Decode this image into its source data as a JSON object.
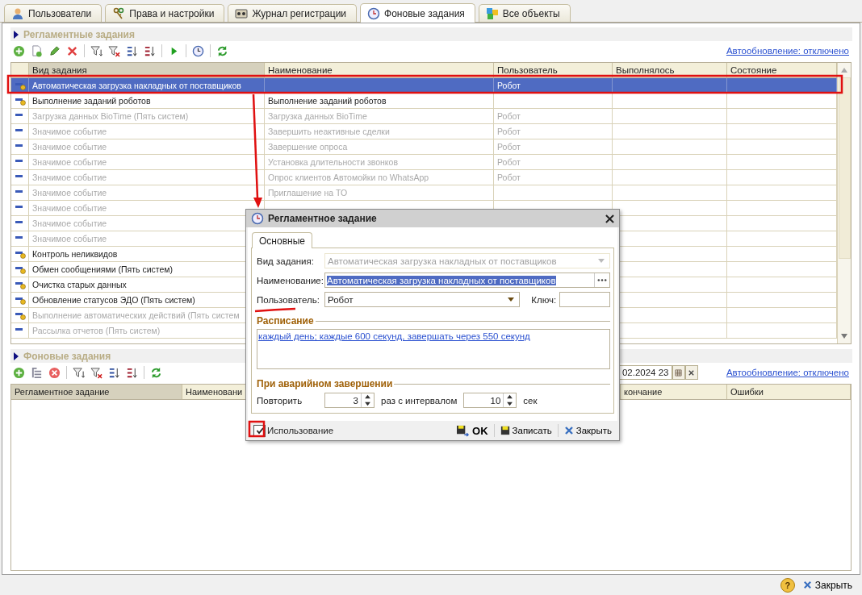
{
  "tabs": [
    {
      "label": "Пользователи",
      "kind": "users",
      "selected": false
    },
    {
      "label": "Права и настройки",
      "kind": "rights",
      "selected": false
    },
    {
      "label": "Журнал регистрации",
      "kind": "log",
      "selected": false
    },
    {
      "label": "Фоновые задания",
      "kind": "jobs",
      "selected": true
    },
    {
      "label": "Все объекты",
      "kind": "objects",
      "selected": false
    }
  ],
  "scheduled": {
    "title": "Регламентные задания",
    "autoupdate": "Автообновление: отключено",
    "columns": [
      "Вид задания",
      "Наименование",
      "Пользователь",
      "Выполнялось",
      "Состояние"
    ],
    "rows": [
      {
        "task": "Автоматическая загрузка накладных от поставщиков",
        "user": "Робот",
        "selected": true,
        "disabled": false,
        "predefined": true
      },
      {
        "task": "Выполнение заданий роботов",
        "name": "Выполнение заданий роботов",
        "selected": false,
        "disabled": false,
        "predefined": true
      },
      {
        "task": "Загрузка данных BioTime (Пять систем)",
        "name": "Загрузка данных BioTime",
        "user": "Робот",
        "selected": false,
        "disabled": true,
        "predefined": false
      },
      {
        "task": "Значимое событие",
        "name": "Завершить неактивные сделки",
        "user": "Робот",
        "selected": false,
        "disabled": true,
        "predefined": false
      },
      {
        "task": "Значимое событие",
        "name": "Завершение опроса",
        "user": "Робот",
        "selected": false,
        "disabled": true,
        "predefined": false
      },
      {
        "task": "Значимое событие",
        "name": "Установка длительности звонков",
        "user": "Робот",
        "selected": false,
        "disabled": true,
        "predefined": false
      },
      {
        "task": "Значимое событие",
        "name": "Опрос клиентов Автомойки по WhatsApp",
        "user": "Робот",
        "selected": false,
        "disabled": true,
        "predefined": false
      },
      {
        "task": "Значимое событие",
        "name": "Приглашение на ТО",
        "selected": false,
        "disabled": true,
        "predefined": false
      },
      {
        "task": "Значимое событие",
        "selected": false,
        "disabled": true,
        "predefined": false
      },
      {
        "task": "Значимое событие",
        "selected": false,
        "disabled": true,
        "predefined": false
      },
      {
        "task": "Значимое событие",
        "selected": false,
        "disabled": true,
        "predefined": false
      },
      {
        "task": "Контроль неликвидов",
        "selected": false,
        "disabled": false,
        "predefined": true
      },
      {
        "task": "Обмен сообщениями (Пять систем)",
        "selected": false,
        "disabled": false,
        "predefined": true
      },
      {
        "task": "Очистка старых данных",
        "selected": false,
        "disabled": false,
        "predefined": true
      },
      {
        "task": "Обновление статусов ЭДО (Пять систем)",
        "selected": false,
        "disabled": false,
        "predefined": true
      },
      {
        "task": "Выполнение автоматических действий (Пять систем",
        "selected": false,
        "disabled": true,
        "predefined": true
      },
      {
        "task": "Рассылка отчетов (Пять систем)",
        "selected": false,
        "disabled": true,
        "predefined": false
      }
    ]
  },
  "background": {
    "title": "Фоновые задания",
    "date": "02.2024 23",
    "autoupdate": "Автообновление: отключено",
    "columns": [
      "Регламентное задание",
      "Наименовани",
      "кончание",
      "Ошибки"
    ]
  },
  "dialog": {
    "title": "Регламентное задание",
    "tabs": [
      {
        "label": "Основные",
        "selected": true
      }
    ],
    "task_label": "Вид задания:",
    "task_value": "Автоматическая загрузка накладных от поставщиков",
    "task_disabled": true,
    "name_label": "Наименование:",
    "name_value": "Автоматическая загрузка накладных от поставщиков",
    "user_label": "Пользователь:",
    "user_value": "Робот",
    "key_label": "Ключ:",
    "schedule_title": "Расписание",
    "schedule_link": "каждый день; каждые 600 секунд, завершать через 550 секунд",
    "failure_title": "При аварийном завершении",
    "repeat_label": "Повторить",
    "repeat_value": "3",
    "interval_label": "раз с интервалом",
    "interval_value": "10",
    "unit": "сек",
    "use": {
      "label": "Использование",
      "checked": true
    },
    "buttons": [
      {
        "label": "OK",
        "kind": "ok"
      },
      {
        "label": "Записать",
        "kind": "save"
      },
      {
        "label": "Закрыть",
        "kind": "close"
      }
    ]
  },
  "status_bar": {
    "help": "?",
    "close": "Закрыть"
  }
}
